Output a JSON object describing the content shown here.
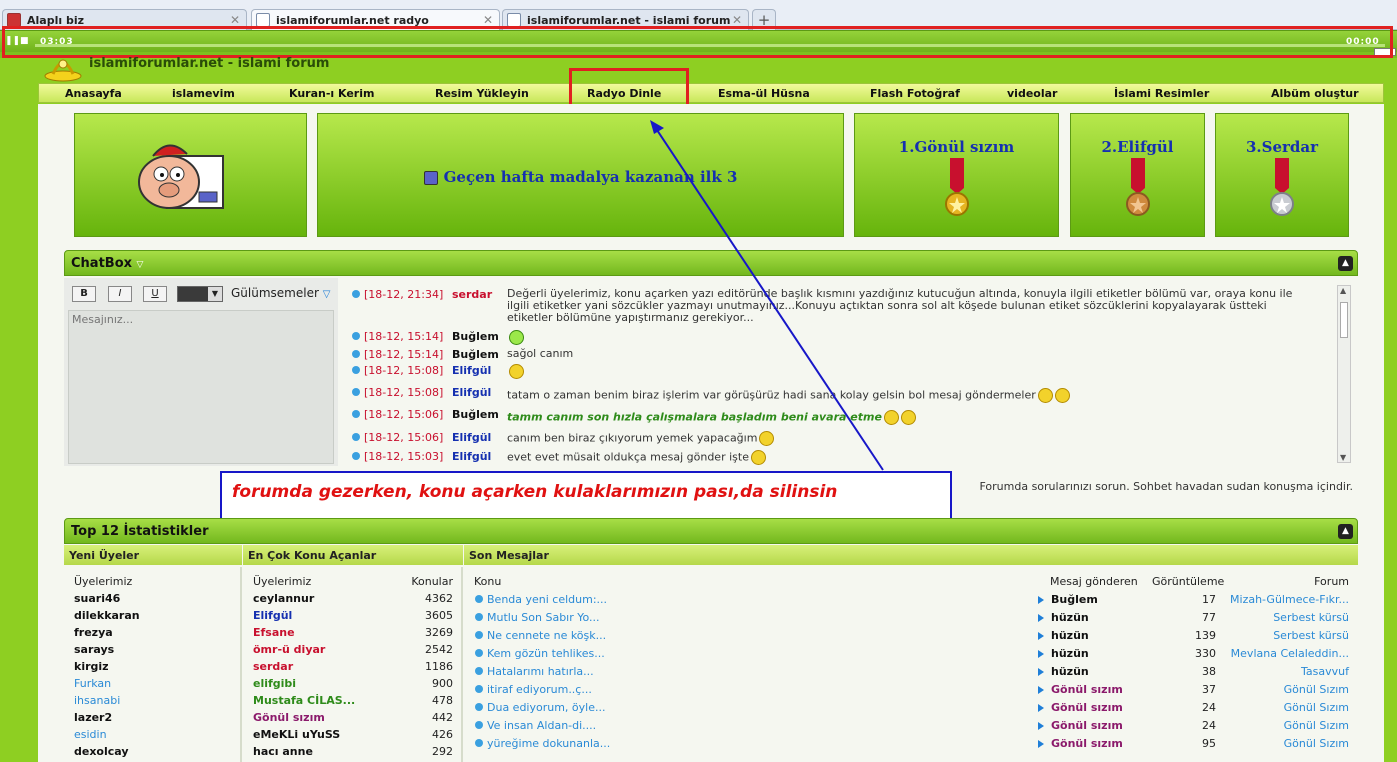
{
  "browser": {
    "tabs": [
      {
        "title": "Alaplı biz"
      },
      {
        "title": "islamiforumlar.net radyo"
      },
      {
        "title": "islamiforumlar.net - islami forum"
      }
    ]
  },
  "player": {
    "elapsed": "03:03",
    "remaining": "00:00",
    "progress": 0.0
  },
  "site": {
    "title": "islamiforumlar.net - islami forum"
  },
  "nav": [
    "Anasayfa",
    "islamevim",
    "Kuran-ı Kerim",
    "Resim Yükleyin",
    "Radyo Dinle",
    "Esma-ül Hüsna",
    "Flash Fotoğraf",
    "videolar",
    "İslami Resimler",
    "Albüm oluştur"
  ],
  "banner": {
    "headline": "Geçen hafta madalya kazanan ilk 3",
    "winners": [
      "1.Gönül sızım",
      "2.Elifgül",
      "3.Serdar"
    ]
  },
  "chatbox": {
    "title": "ChatBox",
    "format": {
      "bold": "B",
      "italic": "I",
      "underline": "U",
      "smilies": "Gülümsemeler"
    },
    "placeholder": "Mesajınız...",
    "messages": [
      {
        "time": "[18-12, 21:34]",
        "user": "serdar",
        "color": "#c8102e",
        "text": "Değerli üyelerimiz, konu açarken yazı editöründe başlık kısmını yazdığınız kutucuğun altında, konuyla ilgili etiketler bölümü var, oraya konu ile ilgili etiketker yani sözcükler yazmayı unutmayınız...Konuyu açtıktan sonra sol alt köşede bulunan etiket sözcüklerini kopyalayarak üstteki etiketler bölümüne yapıştırmanız gerekiyor..."
      },
      {
        "time": "[18-12, 15:14]",
        "user": "Buğlem",
        "color": "#111",
        "text": ""
      },
      {
        "time": "[18-12, 15:14]",
        "user": "Buğlem",
        "color": "#111",
        "text": "sağol canım"
      },
      {
        "time": "[18-12, 15:08]",
        "user": "Elifgül",
        "color": "#1530b0",
        "text": ""
      },
      {
        "time": "[18-12, 15:08]",
        "user": "Elifgül",
        "color": "#1530b0",
        "text": "tatam o zaman benim biraz işlerim var görüşürüz hadi sana kolay gelsin bol mesaj göndermeler"
      },
      {
        "time": "[18-12, 15:06]",
        "user": "Buğlem",
        "color": "#111",
        "text": "tamm canım son hızla çalışmalara başladım beni avara etme"
      },
      {
        "time": "[18-12, 15:06]",
        "user": "Elifgül",
        "color": "#1530b0",
        "text": "canım ben biraz çıkıyorum yemek yapacağım"
      },
      {
        "time": "[18-12, 15:03]",
        "user": "Elifgül",
        "color": "#1530b0",
        "text": "evet evet müsait oldukça mesaj gönder işte"
      }
    ],
    "note": "Forumda sorularınızı sorun. Sohbet havadan sudan konuşma içindir."
  },
  "annotation": "forumda gezerken, konu açarken kulaklarımızın pası,da silinsin",
  "stats": {
    "title": "Top 12 İstatistikler",
    "new_members": {
      "header": "Yeni Üyeler",
      "label": "Üyelerimiz",
      "items": [
        {
          "name": "suari46",
          "color": "#111"
        },
        {
          "name": "dilekkaran",
          "color": "#111"
        },
        {
          "name": "frezya",
          "color": "#111"
        },
        {
          "name": "sarays",
          "color": "#111"
        },
        {
          "name": "kirgiz",
          "color": "#111"
        },
        {
          "name": "Furkan",
          "color": "#2a8ad6"
        },
        {
          "name": "ihsanabi",
          "color": "#2a8ad6"
        },
        {
          "name": "lazer2",
          "color": "#111"
        },
        {
          "name": "esidin",
          "color": "#2a8ad6"
        },
        {
          "name": "dexolcay",
          "color": "#111"
        }
      ]
    },
    "top_posters": {
      "header": "En Çok Konu Açanlar",
      "label": "Üyelerimiz",
      "count_label": "Konular",
      "items": [
        {
          "name": "ceylannur",
          "count": "4362",
          "color": "#111"
        },
        {
          "name": "Elifgül",
          "count": "3605",
          "color": "#1530b0"
        },
        {
          "name": "Efsane",
          "count": "3269",
          "color": "#c8102e"
        },
        {
          "name": "ömr-ü diyar",
          "count": "2542",
          "color": "#c8102e"
        },
        {
          "name": "serdar",
          "count": "1186",
          "color": "#c8102e"
        },
        {
          "name": "elifgibi",
          "count": "900",
          "color": "#2e8b1a"
        },
        {
          "name": "Mustafa CİLAS...",
          "count": "478",
          "color": "#2e8b1a"
        },
        {
          "name": "Gönül sızım",
          "count": "442",
          "color": "#8b1a6b"
        },
        {
          "name": "eMeKLi uYuSS",
          "count": "426",
          "color": "#111"
        },
        {
          "name": "hacı anne",
          "count": "292",
          "color": "#111"
        }
      ]
    },
    "latest": {
      "header": "Son Mesajlar",
      "col_topic": "Konu",
      "col_sender": "Mesaj gönderen",
      "col_views": "Görüntüleme",
      "col_forum": "Forum",
      "items": [
        {
          "topic": "Benda yeni celdum:...",
          "sender": "Buğlem",
          "scolor": "#111",
          "views": "17",
          "forum": "Mizah-Gülmece-Fıkr..."
        },
        {
          "topic": "Mutlu Son Sabır Yo...",
          "sender": "hüzün",
          "scolor": "#111",
          "views": "77",
          "forum": "Serbest kürsü"
        },
        {
          "topic": "Ne cennete ne köşk...",
          "sender": "hüzün",
          "scolor": "#111",
          "views": "139",
          "forum": "Serbest kürsü"
        },
        {
          "topic": "Kem gözün tehlikes...",
          "sender": "hüzün",
          "scolor": "#111",
          "views": "330",
          "forum": "Mevlana Celaleddin..."
        },
        {
          "topic": "Hatalarımı hatırla...",
          "sender": "hüzün",
          "scolor": "#111",
          "views": "38",
          "forum": "Tasavvuf"
        },
        {
          "topic": "itiraf ediyorum..ç...",
          "sender": "Gönül sızım",
          "scolor": "#8b1a6b",
          "views": "37",
          "forum": "Gönül Sızım"
        },
        {
          "topic": "Dua ediyorum, öyle...",
          "sender": "Gönül sızım",
          "scolor": "#8b1a6b",
          "views": "24",
          "forum": "Gönül Sızım"
        },
        {
          "topic": "Ve insan Aldan-di....",
          "sender": "Gönül sızım",
          "scolor": "#8b1a6b",
          "views": "24",
          "forum": "Gönül Sızım"
        },
        {
          "topic": "yüreğime dokunanla...",
          "sender": "Gönül sızım",
          "scolor": "#8b1a6b",
          "views": "95",
          "forum": "Gönül Sızım"
        }
      ]
    }
  }
}
